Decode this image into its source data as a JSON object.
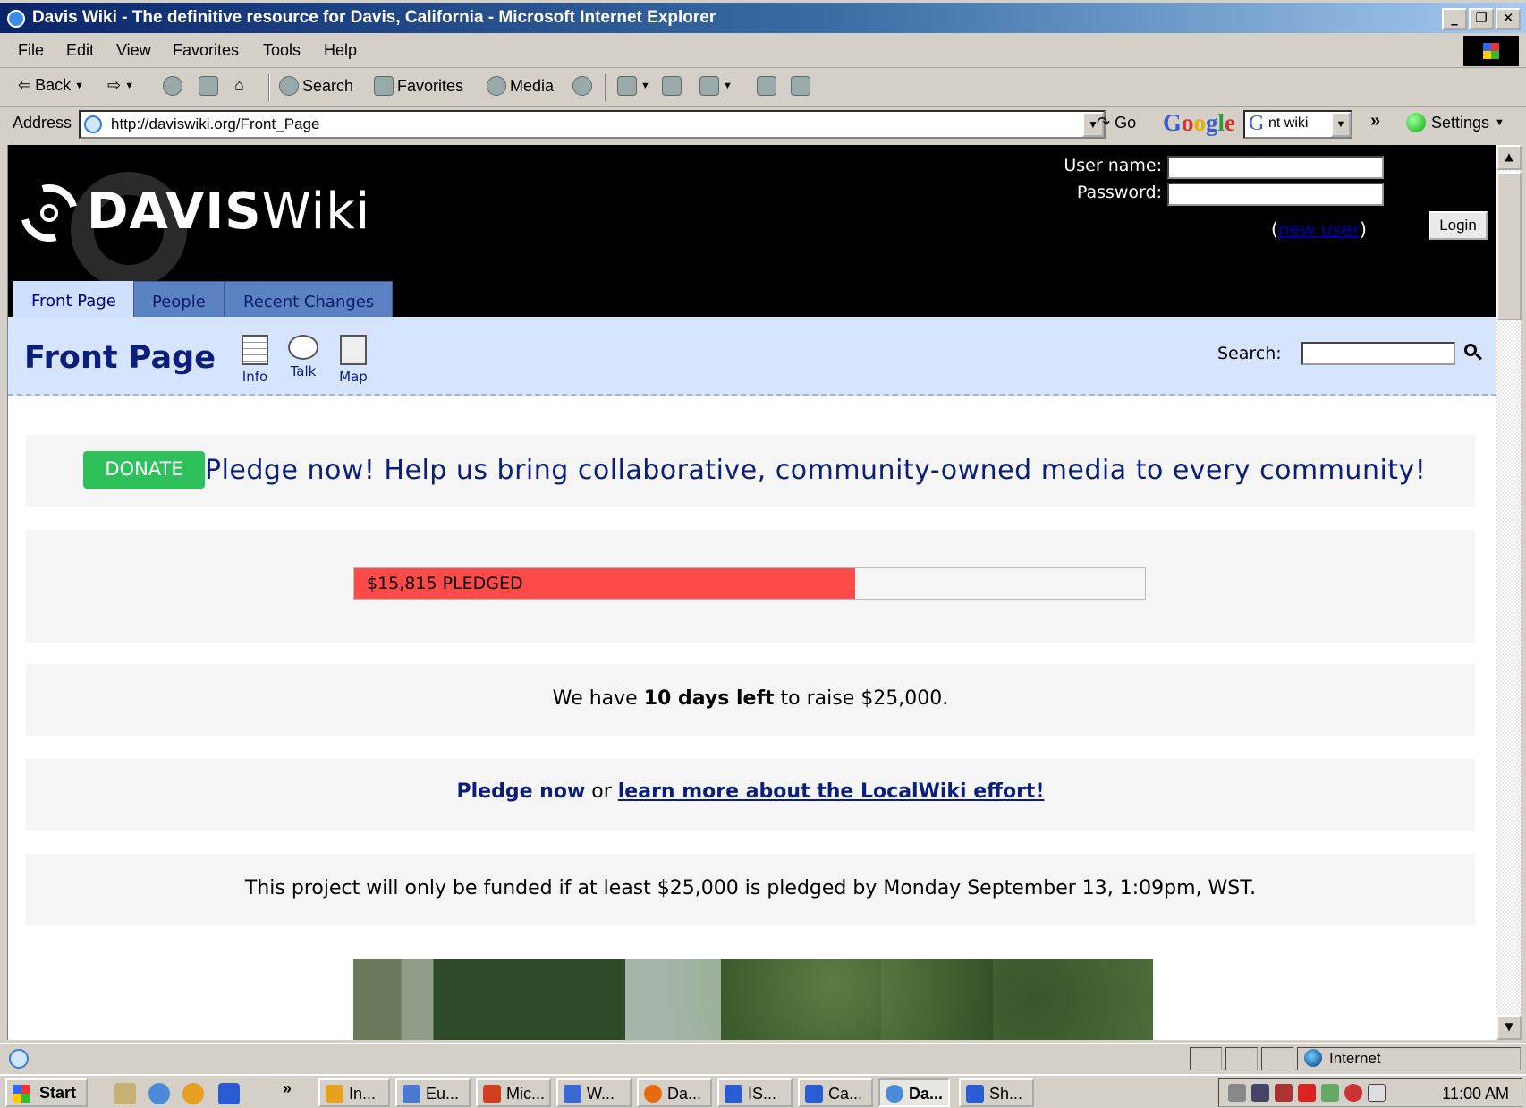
{
  "window": {
    "title": "Davis Wiki - The definitive resource for Davis, California - Microsoft Internet Explorer"
  },
  "menu": [
    "File",
    "Edit",
    "View",
    "Favorites",
    "Tools",
    "Help"
  ],
  "toolbar": {
    "back": "Back",
    "search": "Search",
    "favorites": "Favorites",
    "media": "Media"
  },
  "address": {
    "label": "Address",
    "url": "http://daviswiki.org/Front_Page",
    "go": "Go"
  },
  "google": {
    "logo": "Google",
    "query": "nt wiki",
    "settings": "Settings"
  },
  "wiki": {
    "logo_bold": "DAVIS",
    "logo_light": "Wiki",
    "login": {
      "username_label": "User name:",
      "password_label": "Password:",
      "new_user_open": "(",
      "new_user": "new user",
      "new_user_close": ")",
      "login_button": "Login"
    },
    "tabs": [
      "Front Page",
      "People",
      "Recent Changes"
    ],
    "page_title": "Front Page",
    "page_icons": [
      "Info",
      "Talk",
      "Map"
    ],
    "search_label": "Search:"
  },
  "campaign": {
    "donate": "DONATE",
    "headline": "Pledge now! Help us bring collaborative, community-owned media to every community!",
    "pledged_label": "$15,815 PLEDGED",
    "pledged_fraction": 0.633,
    "days_prefix": "We have ",
    "days_bold": "10 days left",
    "days_suffix": " to raise $25,000.",
    "pledge_now": "Pledge now",
    "or": " or ",
    "learn_more": "learn more about the LocalWiki effort!",
    "condition": "This project will only be funded if at least $25,000 is pledged by Monday September 13, 1:09pm, WST."
  },
  "status": {
    "zone": "Internet"
  },
  "taskbar": {
    "start": "Start",
    "tasks": [
      "In...",
      "Eu...",
      "Mic...",
      "W...",
      "Da...",
      "IS...",
      "Ca...",
      "Da...",
      "Sh..."
    ],
    "clock": "11:00 AM"
  }
}
